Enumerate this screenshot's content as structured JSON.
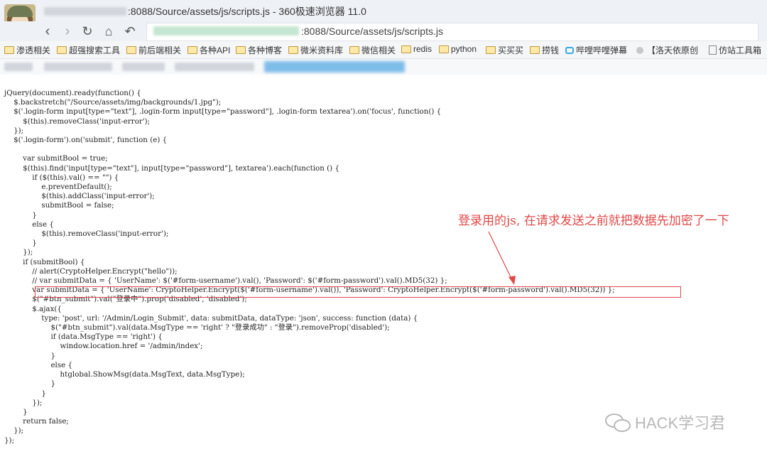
{
  "window": {
    "title": ":8088/Source/assets/js/scripts.js - 360极速浏览器 11.0",
    "url": ":8088/Source/assets/js/scripts.js"
  },
  "nav": {
    "back": "‹",
    "forward": "›",
    "refresh": "↻",
    "home": "⌂",
    "undo": "↶"
  },
  "bookmarks": [
    {
      "label": "渗透相关",
      "icon": "folder-icon"
    },
    {
      "label": "超强搜索工具",
      "icon": "folder-icon"
    },
    {
      "label": "前后端相关",
      "icon": "folder-icon"
    },
    {
      "label": "各种API",
      "icon": "folder-icon"
    },
    {
      "label": "各种博客",
      "icon": "folder-icon"
    },
    {
      "label": "微米资料库",
      "icon": "folder-icon"
    },
    {
      "label": "微信相关",
      "icon": "folder-icon"
    },
    {
      "label": "redis",
      "icon": "folder-icon"
    },
    {
      "label": "python",
      "icon": "folder-icon"
    },
    {
      "label": "买买买",
      "icon": "folder-icon"
    },
    {
      "label": "捞钱",
      "icon": "folder-icon"
    },
    {
      "label": "哔哩哔哩弹幕",
      "icon": "bilibili-icon"
    },
    {
      "label": "【洛天依原创",
      "icon": "gear-icon"
    },
    {
      "label": "仿站工具箱",
      "icon": "page-icon"
    }
  ],
  "code": {
    "lines": [
      "jQuery(document).ready(function() {",
      "    $.backstretch(\"/Source/assets/img/backgrounds/1.jpg\");",
      "    $('.login-form input[type=\"text\"], .login-form input[type=\"password\"], .login-form textarea').on('focus', function() {",
      "        $(this).removeClass('input-error');",
      "    });",
      "    $('.login-form').on('submit', function (e) {",
      "",
      "        var submitBool = true;",
      "        $(this).find('input[type=\"text\"], input[type=\"password\"], textarea').each(function () {",
      "            if ($(this).val() == \"\") {",
      "                e.preventDefault();",
      "                $(this).addClass('input-error');",
      "                submitBool = false;",
      "            }",
      "            else {",
      "                $(this).removeClass('input-error');",
      "            }",
      "        });",
      "        if (submitBool) {",
      "            // alert(CryptoHelper.Encrypt(\"hello\"));",
      "            // var submitData = { 'UserName': $('#form-username').val(), 'Password': $('#form-password').val().MD5(32) };",
      "            var submitData = { 'UserName': CryptoHelper.Encrypt($('#form-username').val()), 'Password': CryptoHelper.Encrypt($('#form-password').val().MD5(32)) };",
      "            $(\"#btn_submit\").val(\"登录中\").prop('disabled', 'disabled');",
      "            $.ajax({",
      "                type: 'post', url: '/Admin/Login_Submit', data: submitData, dataType: 'json', success: function (data) {",
      "                    $(\"#btn_submit\").val(data.MsgType == 'right' ? \"登录成功\" : \"登录\").removeProp('disabled');",
      "                    if (data.MsgType == 'right') {",
      "                        window.location.href = '/admin/index';",
      "                    }",
      "                    else {",
      "                        htglobal.ShowMsg(data.MsgText, data.MsgType);",
      "                    }",
      "                }",
      "            });",
      "        }",
      "        return false;",
      "    });",
      "});"
    ]
  },
  "annotation": {
    "text": "登录用的js, 在请求发送之前就把数据先加密了一下",
    "color": "#e04848"
  },
  "watermark": {
    "text": "HACK学习君"
  }
}
